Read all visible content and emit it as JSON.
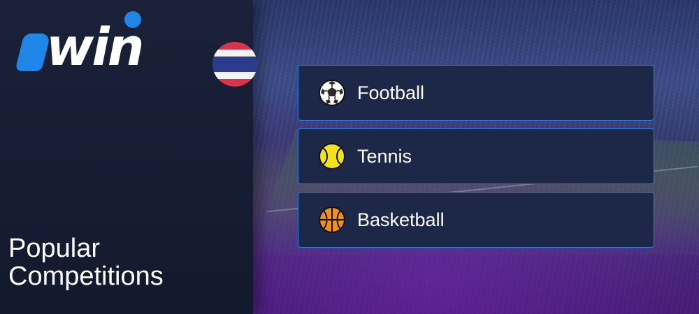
{
  "brand": {
    "logo_text": "1win",
    "flag_icon": "thailand-flag-icon",
    "accent_color": "#1f86e8"
  },
  "left_panel": {
    "heading_line1": "Popular",
    "heading_line2": "Competitions"
  },
  "sports": [
    {
      "label": "Football",
      "icon": "soccer-ball-icon"
    },
    {
      "label": "Tennis",
      "icon": "tennis-ball-icon"
    },
    {
      "label": "Basketball",
      "icon": "basketball-icon"
    }
  ],
  "colors": {
    "button_background": "#1d2849",
    "button_border": "#2f7fe0",
    "panel_background": "#161c32"
  }
}
